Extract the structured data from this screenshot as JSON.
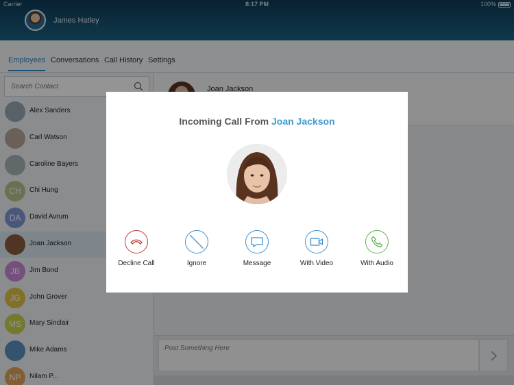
{
  "status_bar": {
    "carrier": "Carrier",
    "time": "8:17 PM",
    "battery": "100%"
  },
  "user": {
    "name": "James Hatley"
  },
  "tabs": [
    {
      "label": "Employees",
      "active": true
    },
    {
      "label": "Conversations",
      "active": false
    },
    {
      "label": "Call History",
      "active": false
    },
    {
      "label": "Settings",
      "active": false
    }
  ],
  "search": {
    "placeholder": "Search Contact"
  },
  "contacts": [
    {
      "name": "Alex Sanders",
      "initials": "",
      "color": "#9aa7b0"
    },
    {
      "name": "Carl Watson",
      "initials": "",
      "color": "#b7a59a"
    },
    {
      "name": "Caroline Bayers",
      "initials": "",
      "color": "#a9b1b5"
    },
    {
      "name": "Chi Hung",
      "initials": "CH",
      "color": "#b9c18f"
    },
    {
      "name": "David Avrum",
      "initials": "DA",
      "color": "#7f97d8"
    },
    {
      "name": "Joan Jackson",
      "initials": "",
      "color": "#8b5a3e",
      "selected": true
    },
    {
      "name": "Jim Bond",
      "initials": "JB",
      "color": "#c98bd8"
    },
    {
      "name": "John Grover",
      "initials": "JG",
      "color": "#e0c247"
    },
    {
      "name": "Mary Sinclair",
      "initials": "MS",
      "color": "#c9d14f"
    },
    {
      "name": "Mike Adams",
      "initials": "",
      "color": "#5a8fc0"
    },
    {
      "name": "Nilam P...",
      "initials": "NP",
      "color": "#e0a25a"
    }
  ],
  "chat": {
    "contact_name": "Joan Jackson",
    "post_placeholder": "Post Something Here"
  },
  "incoming_call": {
    "title_prefix": "Incoming Call From",
    "caller_name": "Joan Jackson",
    "actions": [
      {
        "label": "Decline Call",
        "icon": "decline-call-icon",
        "color": "#c0392b"
      },
      {
        "label": "Ignore",
        "icon": "ignore-icon",
        "color": "#3b8fd0"
      },
      {
        "label": "Message",
        "icon": "message-icon",
        "color": "#3b8fd0"
      },
      {
        "label": "With Video",
        "icon": "video-icon",
        "color": "#3b8fd0"
      },
      {
        "label": "With Audio",
        "icon": "phone-icon",
        "color": "#5bb54a"
      }
    ]
  },
  "colors": {
    "accent": "#2b86c3",
    "caller_name": "#3d9ad1",
    "header": "#1d6283"
  }
}
